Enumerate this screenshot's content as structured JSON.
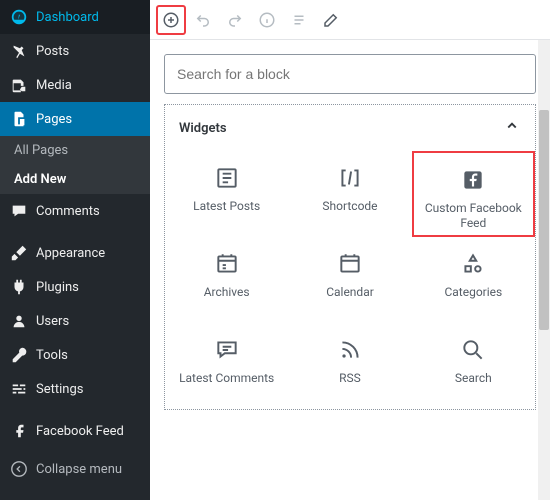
{
  "sidebar": {
    "items": [
      {
        "label": "Dashboard",
        "icon": "dashboard"
      },
      {
        "label": "Posts",
        "icon": "pin"
      },
      {
        "label": "Media",
        "icon": "media"
      },
      {
        "label": "Pages",
        "icon": "pages",
        "active": true
      },
      {
        "label": "Comments",
        "icon": "comment"
      },
      {
        "label": "Appearance",
        "icon": "brush"
      },
      {
        "label": "Plugins",
        "icon": "plug"
      },
      {
        "label": "Users",
        "icon": "user"
      },
      {
        "label": "Tools",
        "icon": "wrench"
      },
      {
        "label": "Settings",
        "icon": "sliders"
      },
      {
        "label": "Facebook Feed",
        "icon": "facebook"
      }
    ],
    "sub": [
      {
        "label": "All Pages"
      },
      {
        "label": "Add New",
        "current": true
      }
    ],
    "collapse_label": "Collapse menu"
  },
  "toolbar": {
    "buttons": [
      "add",
      "undo",
      "redo",
      "info",
      "list",
      "edit"
    ]
  },
  "search": {
    "placeholder": "Search for a block"
  },
  "section": {
    "title": "Widgets"
  },
  "blocks": [
    {
      "label": "Latest Posts",
      "icon": "latest-posts"
    },
    {
      "label": "Shortcode",
      "icon": "shortcode"
    },
    {
      "label": "Custom Facebook Feed",
      "icon": "facebook-box",
      "highlight": true
    },
    {
      "label": "Archives",
      "icon": "archives"
    },
    {
      "label": "Calendar",
      "icon": "calendar"
    },
    {
      "label": "Categories",
      "icon": "categories"
    },
    {
      "label": "Latest Comments",
      "icon": "latest-comments"
    },
    {
      "label": "RSS",
      "icon": "rss"
    },
    {
      "label": "Search",
      "icon": "search"
    }
  ],
  "highlights": {
    "add_button": true
  }
}
